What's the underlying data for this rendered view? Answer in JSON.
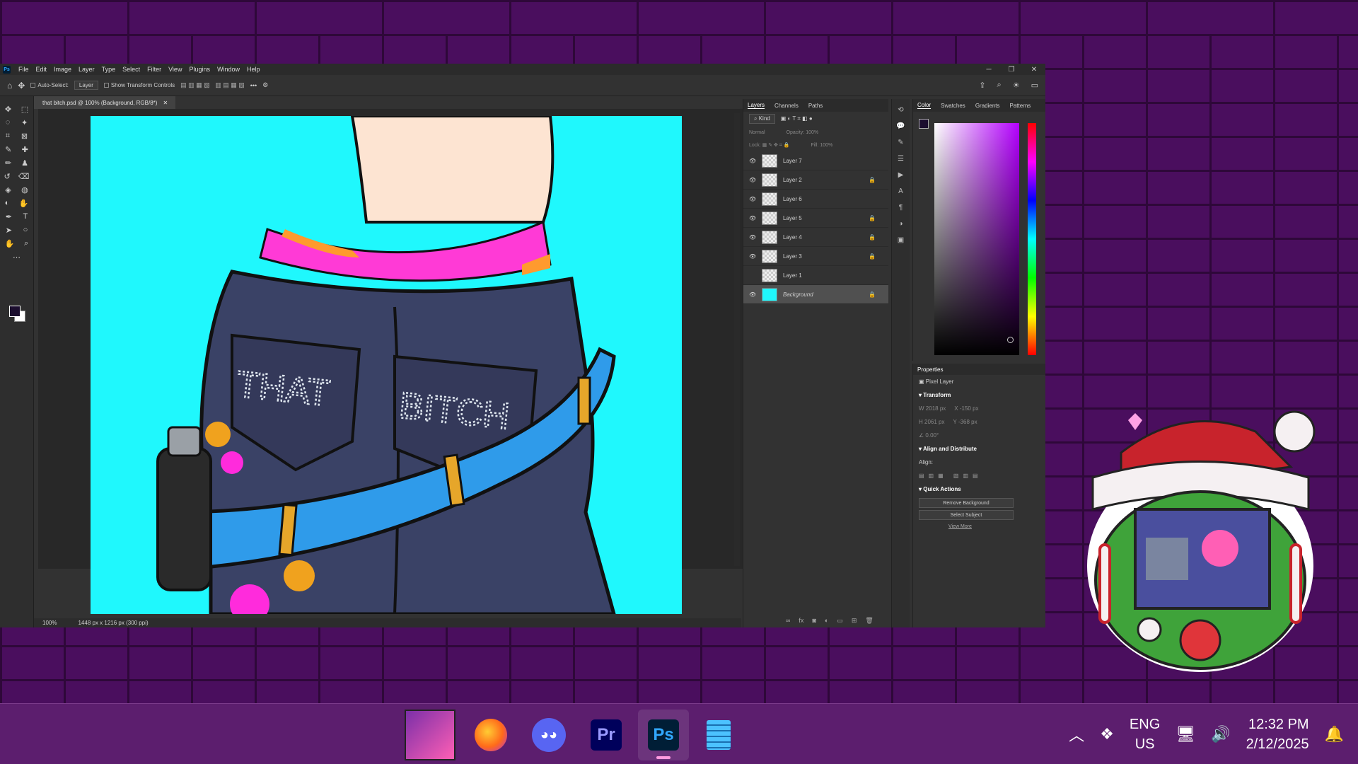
{
  "photoshop": {
    "logo": "Ps",
    "menu": [
      "File",
      "Edit",
      "Image",
      "Layer",
      "Type",
      "Select",
      "Filter",
      "View",
      "Plugins",
      "Window",
      "Help"
    ],
    "options": {
      "auto_select_label": "Auto-Select:",
      "auto_select_value": "Layer",
      "transform_label": "Show Transform Controls"
    },
    "document_tab": "that bitch.psd @ 100% (Background, RGB/8*)",
    "status": {
      "zoom": "100%",
      "dimensions": "1448 px x 1216 px (300 ppi)"
    },
    "canvas_text": {
      "left_pocket": "THAT",
      "right_pocket": "BITCH"
    }
  },
  "layers_panel": {
    "tabs": [
      "Layers",
      "Channels",
      "Paths"
    ],
    "filter_label": "Kind",
    "blend_mode": "Normal",
    "opacity_label": "Opacity:",
    "opacity_value": "100%",
    "lock_label": "Lock:",
    "fill_label": "Fill:",
    "fill_value": "100%",
    "layers": [
      {
        "name": "Layer 7",
        "visible": true,
        "locked": false
      },
      {
        "name": "Layer 2",
        "visible": true,
        "locked": true
      },
      {
        "name": "Layer 6",
        "visible": true,
        "locked": false
      },
      {
        "name": "Layer 5",
        "visible": true,
        "locked": true
      },
      {
        "name": "Layer 4",
        "visible": true,
        "locked": true
      },
      {
        "name": "Layer 3",
        "visible": true,
        "locked": true
      },
      {
        "name": "Layer 1",
        "visible": false,
        "locked": false
      },
      {
        "name": "Background",
        "visible": true,
        "locked": true
      }
    ]
  },
  "color_panel": {
    "tabs": [
      "Color",
      "Swatches",
      "Gradients",
      "Patterns"
    ],
    "foreground_color": "#1b0d2e",
    "hue_color": "#b400ff"
  },
  "properties_panel": {
    "title": "Properties",
    "layer_type": "Pixel Layer",
    "transform_label": "Transform",
    "w_label": "W",
    "w_value": "2018 px",
    "h_label": "H",
    "h_value": "2061 px",
    "x_label": "X",
    "x_value": "-150 px",
    "y_label": "Y",
    "y_value": "-368 px",
    "angle_value": "0.00°",
    "align_label": "Align and Distribute",
    "align_sub": "Align:",
    "quick_actions_label": "Quick Actions",
    "remove_bg_button": "Remove Background",
    "select_subject_button": "Select Subject",
    "view_more_link": "View More"
  },
  "taskbar": {
    "apps": [
      {
        "name": "Photo app",
        "icon": "avatar-icon"
      },
      {
        "name": "Firefox",
        "icon": "firefox-icon"
      },
      {
        "name": "Discord",
        "icon": "discord-icon"
      },
      {
        "name": "Premiere Pro",
        "label": "Pr",
        "icon": "premiere-icon"
      },
      {
        "name": "Photoshop",
        "label": "Ps",
        "icon": "photoshop-icon",
        "active": true
      },
      {
        "name": "Notepad",
        "icon": "notepad-icon"
      }
    ],
    "lang_line1": "ENG",
    "lang_line2": "US",
    "time": "12:32 PM",
    "date": "2/12/2025"
  }
}
